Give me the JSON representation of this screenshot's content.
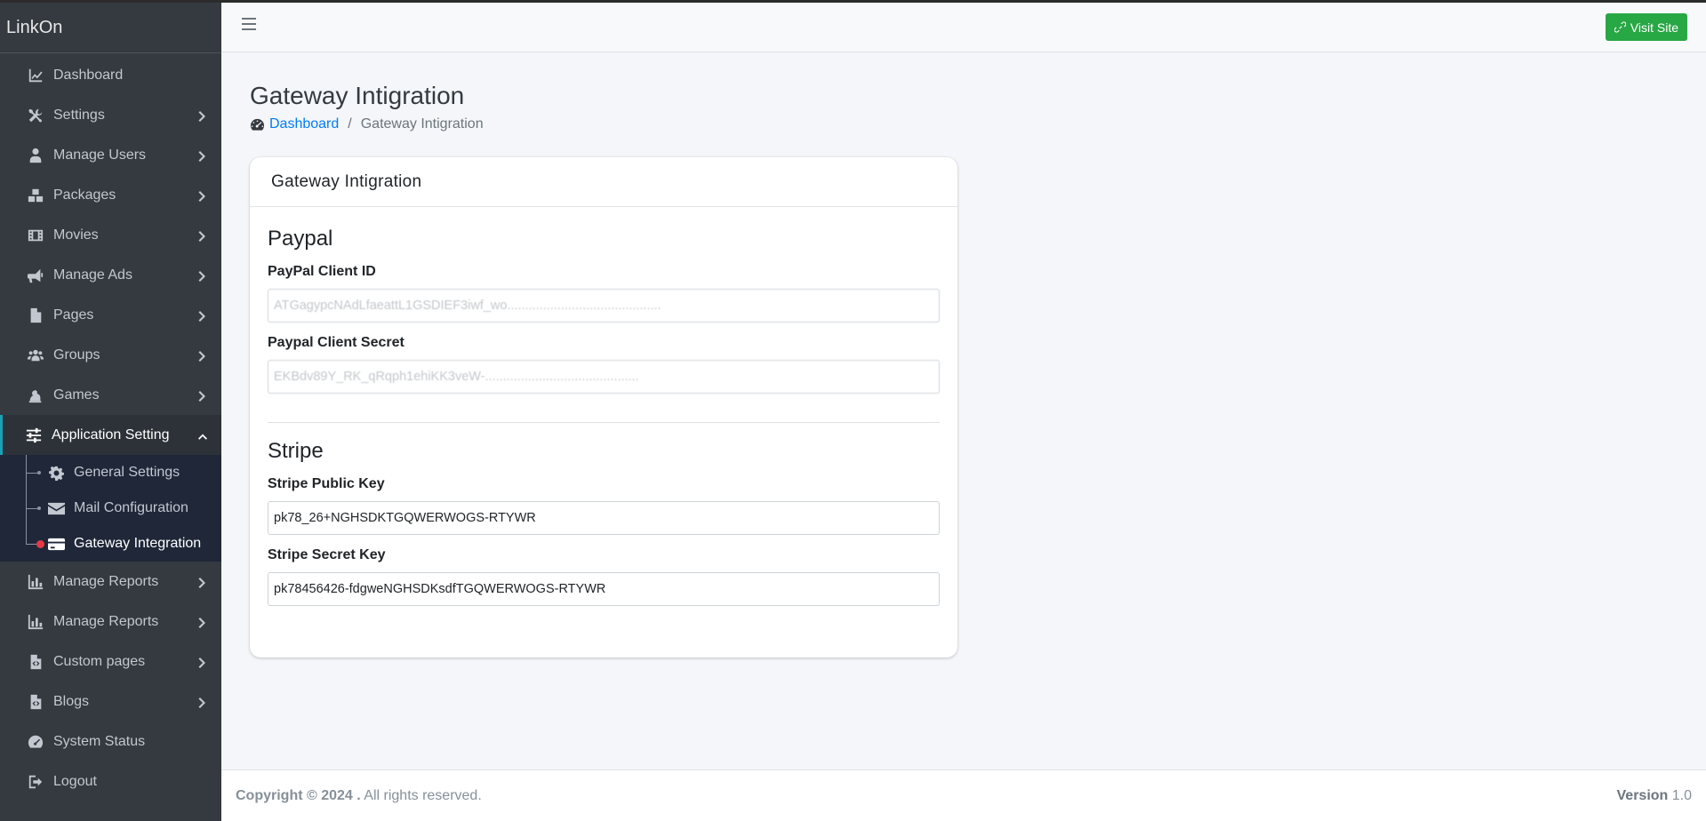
{
  "app": {
    "name": "LinkOn"
  },
  "header": {
    "visit_site_label": "Visit Site"
  },
  "sidebar": {
    "items": [
      {
        "label": "Dashboard",
        "icon": "chart-line-icon",
        "has_children": false
      },
      {
        "label": "Settings",
        "icon": "tools-icon",
        "has_children": true
      },
      {
        "label": "Manage Users",
        "icon": "user-icon",
        "has_children": true
      },
      {
        "label": "Packages",
        "icon": "boxes-icon",
        "has_children": true
      },
      {
        "label": "Movies",
        "icon": "film-icon",
        "has_children": true
      },
      {
        "label": "Manage Ads",
        "icon": "bullhorn-icon",
        "has_children": true
      },
      {
        "label": "Pages",
        "icon": "file-icon",
        "has_children": true
      },
      {
        "label": "Groups",
        "icon": "users-icon",
        "has_children": true
      },
      {
        "label": "Games",
        "icon": "game-icon",
        "has_children": true
      },
      {
        "label": "Application Setting",
        "icon": "sliders-icon",
        "has_children": true,
        "expanded": true
      },
      {
        "label": "Manage Reports",
        "icon": "chart-bar-icon",
        "has_children": true
      },
      {
        "label": "Manage Reports",
        "icon": "chart-bar-icon",
        "has_children": true
      },
      {
        "label": "Custom pages",
        "icon": "file-code-icon",
        "has_children": true
      },
      {
        "label": "Blogs",
        "icon": "file-code-icon",
        "has_children": true
      },
      {
        "label": "System Status",
        "icon": "gauge-icon",
        "has_children": false
      },
      {
        "label": "Logout",
        "icon": "logout-icon",
        "has_children": false
      }
    ],
    "subitems": [
      {
        "label": "General Settings",
        "icon": "gear-icon"
      },
      {
        "label": "Mail Configuration",
        "icon": "envelope-icon"
      },
      {
        "label": "Gateway Integration",
        "icon": "credit-card-icon",
        "active": true
      }
    ]
  },
  "page": {
    "title": "Gateway Intigration",
    "breadcrumb": {
      "home": "Dashboard",
      "separator": "/",
      "current": "Gateway Intigration"
    }
  },
  "card": {
    "header": "Gateway Intigration",
    "paypal": {
      "section_title": "Paypal",
      "client_id_label": "PayPal Client ID",
      "client_id_value": "ATGagypcNAdLfaeattL1GSDIEF3iwf_wo...........................................",
      "client_secret_label": "Paypal Client Secret",
      "client_secret_value": "EKBdv89Y_RK_qRqph1ehiKK3veW-..........................................."
    },
    "stripe": {
      "section_title": "Stripe",
      "public_key_label": "Stripe Public Key",
      "public_key_value": "pk78_26+NGHSDKTGQWERWOGS-RTYWR",
      "secret_key_label": "Stripe Secret Key",
      "secret_key_value": "pk78456426-fdgweNGHSDKsdfTGQWERWOGS-RTYWR"
    }
  },
  "footer": {
    "copyright_bold": "Copyright © 2024 .",
    "copyright_rest": " All rights reserved.",
    "version_label": "Version",
    "version_value": " 1.0"
  },
  "colors": {
    "sidebar_bg": "#343a40",
    "accent_green": "#28a745",
    "link_blue": "#007bff",
    "active_dot": "#e63946"
  }
}
